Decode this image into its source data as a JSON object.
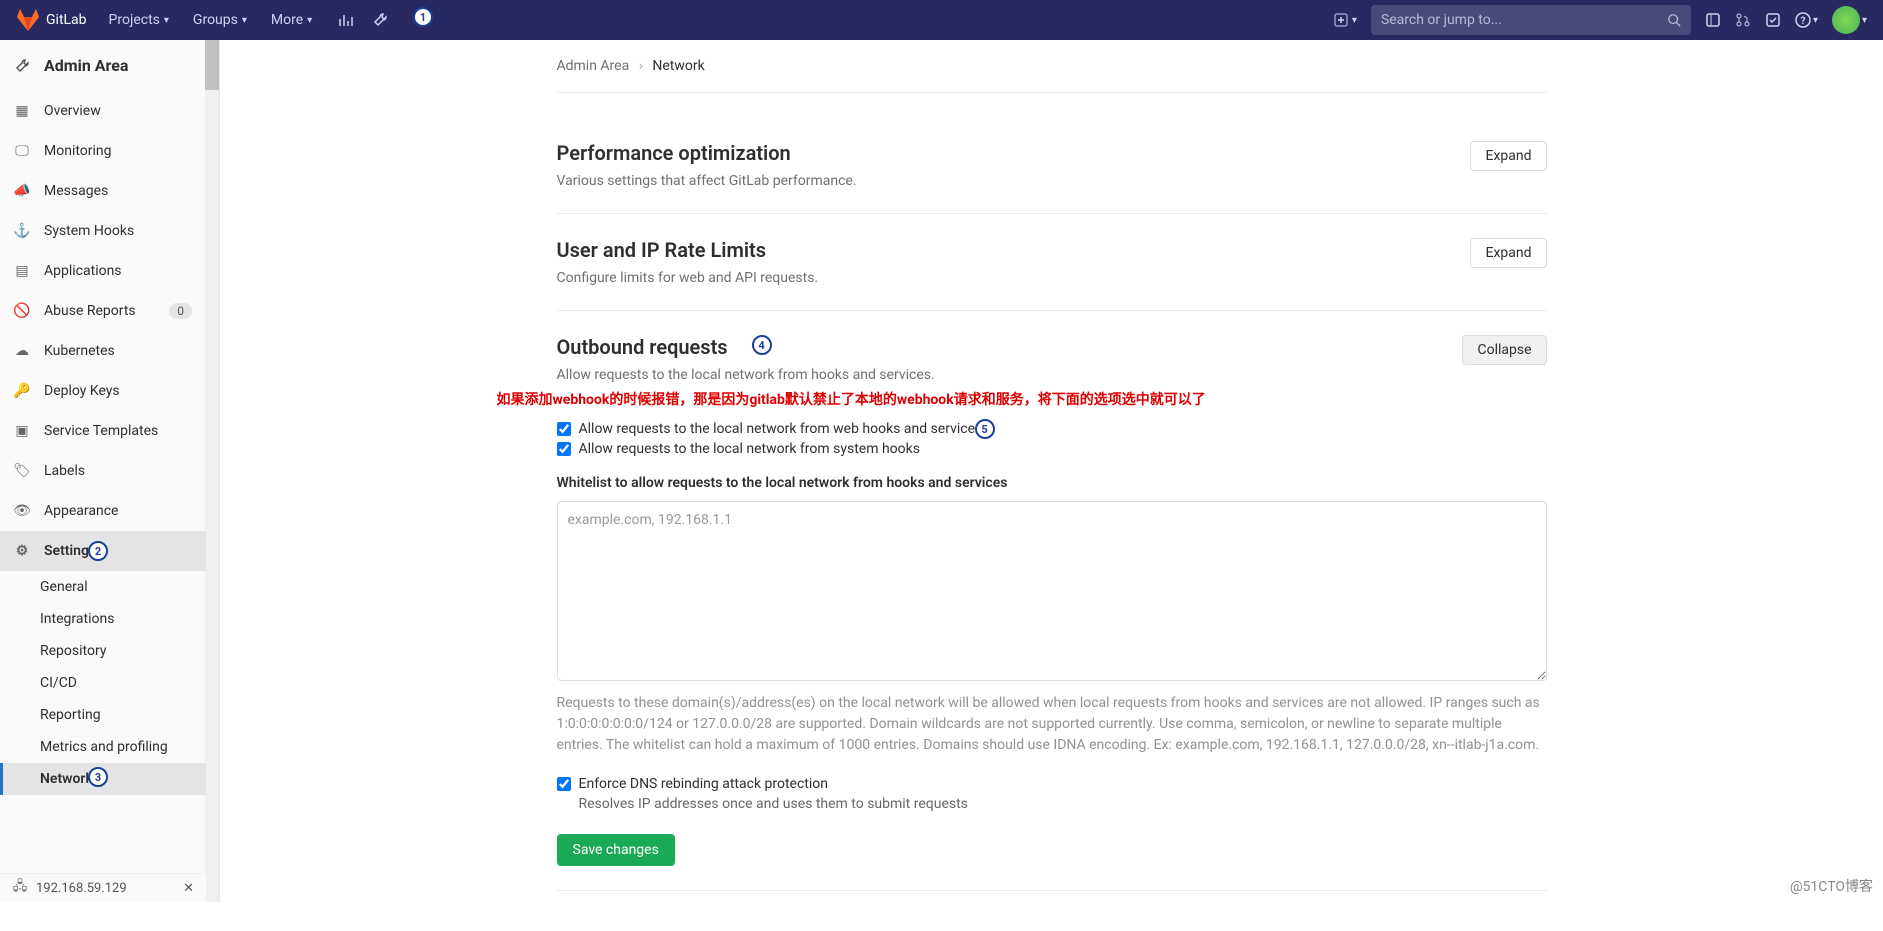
{
  "topbar": {
    "brand": "GitLab",
    "nav": {
      "projects": "Projects",
      "groups": "Groups",
      "more": "More"
    },
    "search_placeholder": "Search or jump to..."
  },
  "sidebar": {
    "title": "Admin Area",
    "items": [
      {
        "label": "Overview",
        "icon": "grid-icon"
      },
      {
        "label": "Monitoring",
        "icon": "monitor-icon"
      },
      {
        "label": "Messages",
        "icon": "megaphone-icon"
      },
      {
        "label": "System Hooks",
        "icon": "hook-icon"
      },
      {
        "label": "Applications",
        "icon": "apps-icon"
      },
      {
        "label": "Abuse Reports",
        "icon": "abuse-icon",
        "badge": "0"
      },
      {
        "label": "Kubernetes",
        "icon": "cloud-icon"
      },
      {
        "label": "Deploy Keys",
        "icon": "key-icon"
      },
      {
        "label": "Service Templates",
        "icon": "template-icon"
      },
      {
        "label": "Labels",
        "icon": "label-icon"
      },
      {
        "label": "Appearance",
        "icon": "appearance-icon"
      },
      {
        "label": "Settings",
        "icon": "settings-icon"
      }
    ],
    "sub": [
      {
        "label": "General"
      },
      {
        "label": "Integrations"
      },
      {
        "label": "Repository"
      },
      {
        "label": "CI/CD"
      },
      {
        "label": "Reporting"
      },
      {
        "label": "Metrics and profiling"
      },
      {
        "label": "Network"
      }
    ],
    "footer_ip": "192.168.59.129"
  },
  "breadcrumb": {
    "root": "Admin Area",
    "current": "Network"
  },
  "sections": {
    "perf": {
      "title": "Performance optimization",
      "desc": "Various settings that affect GitLab performance.",
      "btn": "Expand"
    },
    "rate": {
      "title": "User and IP Rate Limits",
      "desc": "Configure limits for web and API requests.",
      "btn": "Expand"
    },
    "outbound": {
      "title": "Outbound requests",
      "desc": "Allow requests to the local network from hooks and services.",
      "btn": "Collapse",
      "chk1": "Allow requests to the local network from web hooks and services",
      "chk2": "Allow requests to the local network from system hooks",
      "whitelist_label": "Whitelist to allow requests to the local network from hooks and services",
      "whitelist_placeholder": "example.com, 192.168.1.1",
      "help": "Requests to these domain(s)/address(es) on the local network will be allowed when local requests from hooks and services are not allowed. IP ranges such as 1:0:0:0:0:0:0:0/124 or 127.0.0.0/28 are supported. Domain wildcards are not supported currently. Use comma, semicolon, or newline to separate multiple entries. The whitelist can hold a maximum of 1000 entries. Domains should use IDNA encoding. Ex: example.com, 192.168.1.1, 127.0.0.0/28, xn--itlab-j1a.com.",
      "dns_chk": "Enforce DNS rebinding attack protection",
      "dns_help": "Resolves IP addresses once and uses them to submit requests",
      "save": "Save changes"
    }
  },
  "annotation_text": "如果添加webhook的时候报错，那是因为gitlab默认禁止了本地的webhook请求和服务，将下面的选项选中就可以了",
  "watermark": "@51CTO博客"
}
